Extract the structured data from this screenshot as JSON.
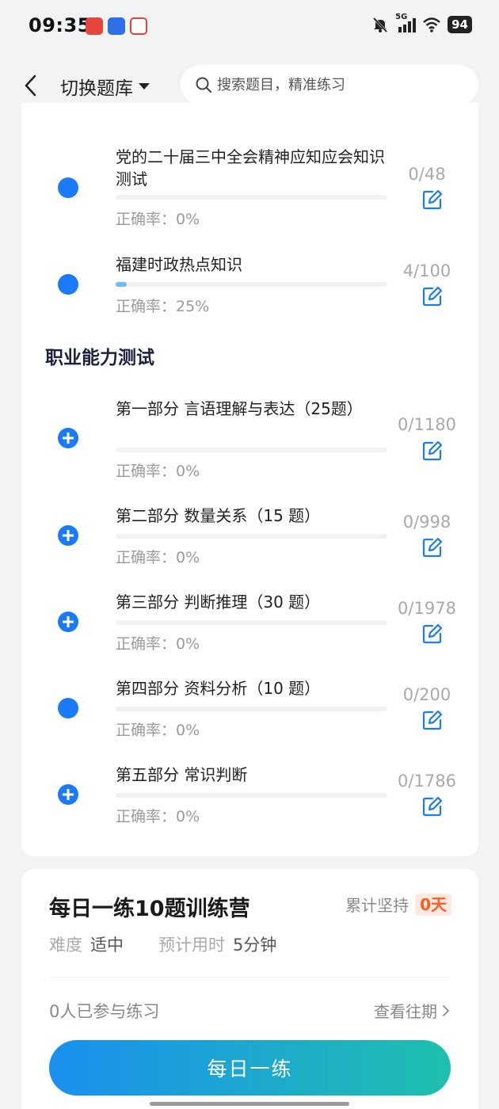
{
  "status_bar": {
    "time": "09:35",
    "network": "5G",
    "battery": "94"
  },
  "header": {
    "bank_switch_label": "切换题库",
    "search_placeholder": "搜索题目，精准练习"
  },
  "colors": {
    "accent": "#1a7af8",
    "streak": "#ff5a1f",
    "cta_start": "#1a90f0",
    "cta_end": "#1fbfae"
  },
  "list": {
    "top_items": [
      {
        "title": "党的二十届三中全会精神应知应会知识测试",
        "count": "0/48",
        "accuracy": "正确率：0%",
        "progress": 0,
        "icon": "dot"
      },
      {
        "title": "福建时政热点知识",
        "count": "4/100",
        "accuracy": "正确率：25%",
        "progress": 0.04,
        "icon": "dot"
      }
    ],
    "section_title": "职业能力测试",
    "section_items": [
      {
        "title": "第一部分 言语理解与表达（25题）",
        "count": "0/1180",
        "accuracy": "正确率：0%",
        "progress": 0,
        "icon": "plus"
      },
      {
        "title": "第二部分 数量关系（15 题）",
        "count": "0/998",
        "accuracy": "正确率：0%",
        "progress": 0,
        "icon": "plus"
      },
      {
        "title": "第三部分 判断推理（30 题）",
        "count": "0/1978",
        "accuracy": "正确率：0%",
        "progress": 0,
        "icon": "plus"
      },
      {
        "title": "第四部分 资料分析（10 题）",
        "count": "0/200",
        "accuracy": "正确率：0%",
        "progress": 0,
        "icon": "dot"
      },
      {
        "title": "第五部分 常识判断",
        "count": "0/1786",
        "accuracy": "正确率：0%",
        "progress": 0,
        "icon": "plus"
      }
    ]
  },
  "camp": {
    "title": "每日一练10题训练营",
    "streak_label": "累计坚持",
    "streak_value": "0天",
    "difficulty_label": "难度",
    "difficulty_value": "适中",
    "time_label": "预计用时",
    "time_value": "5分钟",
    "participants": "0人已参与练习",
    "history_link": "查看往期",
    "cta_label": "每日一练"
  }
}
